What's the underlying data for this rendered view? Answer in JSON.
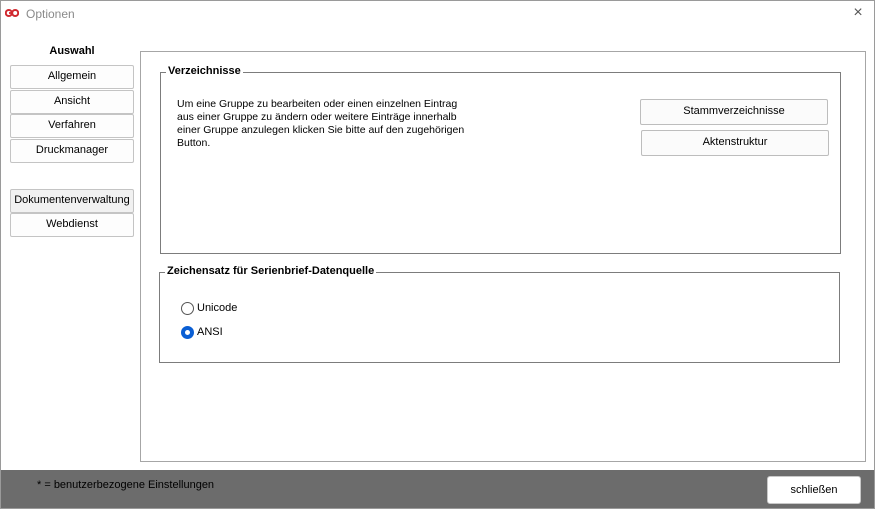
{
  "window": {
    "title": "Optionen",
    "app_icon": "go-logo-icon",
    "close_icon": "×"
  },
  "sidebar": {
    "heading": "Auswahl",
    "items": [
      {
        "label": "Allgemein"
      },
      {
        "label": "Ansicht"
      },
      {
        "label": "Verfahren"
      },
      {
        "label": "Druckmanager"
      },
      {
        "label": "Dokumentenverwaltung"
      },
      {
        "label": "Webdienst"
      }
    ]
  },
  "directories": {
    "title": "Verzeichnisse",
    "description": "Um eine Gruppe zu bearbeiten oder einen einzelnen Eintrag aus einer Gruppe zu ändern oder weitere Einträge innerhalb einer Gruppe anzulegen klicken Sie bitte auf den zugehörigen Button.",
    "buttons": [
      {
        "label": "Stammverzeichnisse"
      },
      {
        "label": "Aktenstruktur"
      }
    ]
  },
  "charset": {
    "title": "Zeichensatz für Serienbrief-Datenquelle",
    "options": [
      {
        "label": "Unicode",
        "selected": false
      },
      {
        "label": "ANSI",
        "selected": true
      }
    ]
  },
  "footer": {
    "note": "*  = benutzerbezogene Einstellungen",
    "close_label": "schließen"
  },
  "colors": {
    "accent": "#0b5fd4",
    "logo_red": "#d0282e",
    "footer_bg": "#6c6c6c"
  }
}
